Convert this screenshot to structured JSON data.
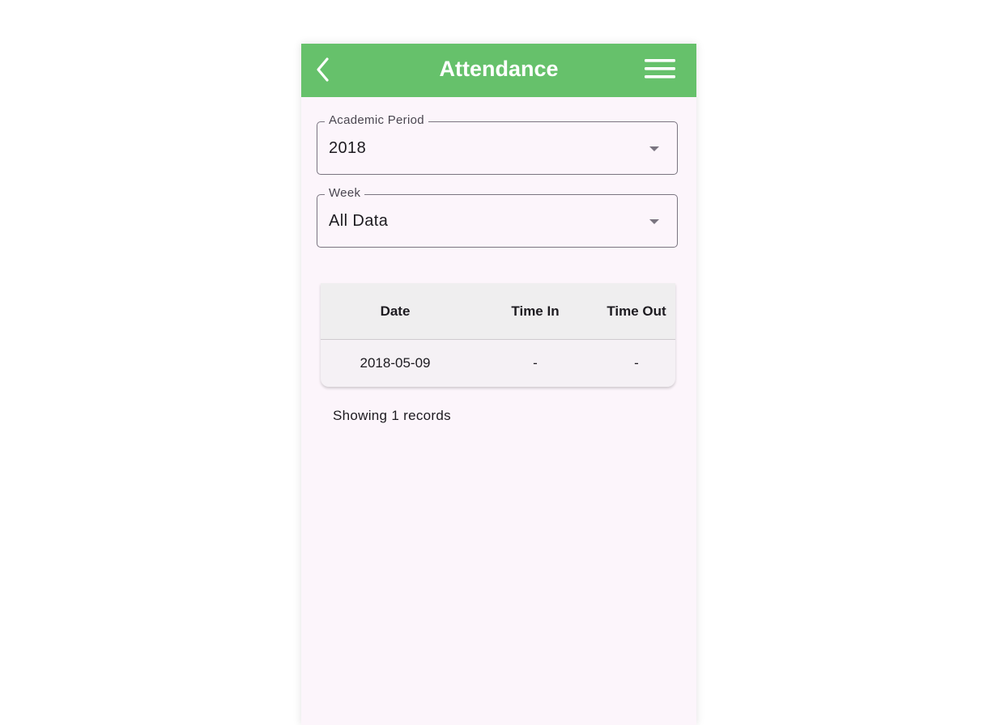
{
  "appbar": {
    "title": "Attendance",
    "back_icon": "chevron-left-icon",
    "menu_icon": "hamburger-menu-icon",
    "color": "#66c16b"
  },
  "filters": {
    "academic_period": {
      "label": "Academic Period",
      "value": "2018"
    },
    "week": {
      "label": "Week",
      "value": "All Data"
    }
  },
  "table": {
    "columns": [
      "Date",
      "Time In",
      "Time Out"
    ],
    "rows": [
      [
        "2018-05-09",
        "-",
        "-"
      ]
    ]
  },
  "footer": {
    "records_text": "Showing 1 records"
  }
}
